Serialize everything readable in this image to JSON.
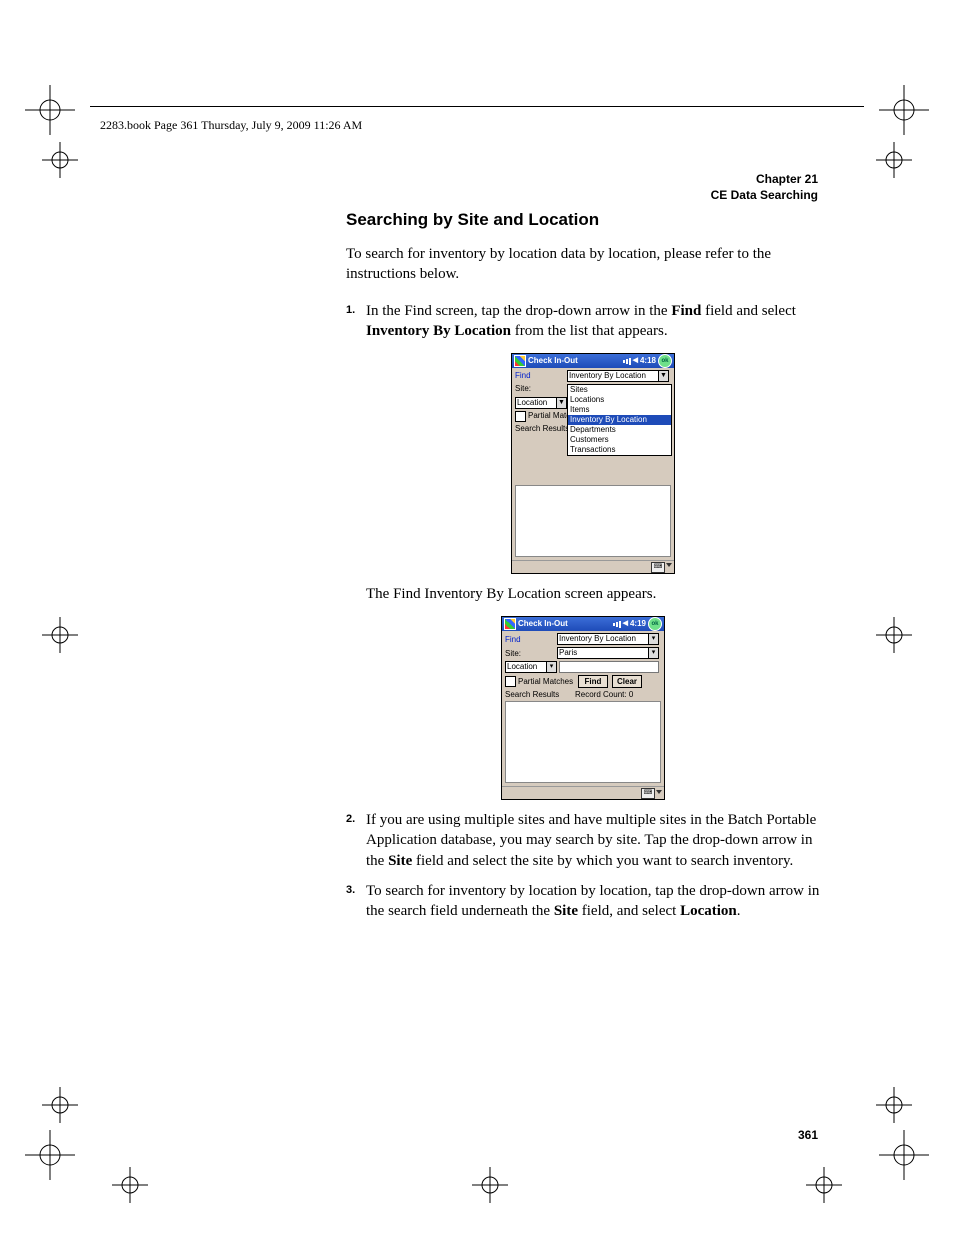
{
  "page_header": "2283.book  Page 361  Thursday, July 9, 2009  11:26 AM",
  "chapter_line1": "Chapter 21",
  "chapter_line2": "CE Data Searching",
  "section_title": "Searching by Site and Location",
  "intro": "To search for inventory by location data by location, please refer to the instructions below.",
  "step1_a": "In the Find screen, tap the drop-down arrow in the ",
  "step1_b": "Find",
  "step1_c": " field and select ",
  "step1_d": "Inventory By Location",
  "step1_e": " from the list that appears.",
  "caption1": "The Find Inventory By Location screen appears.",
  "step2_a": "If you are using multiple sites and have multiple sites in the Batch Portable Application database, you may search by site. Tap the drop-down arrow in the ",
  "step2_b": "Site",
  "step2_c": " field and select the site by which you want to search inventory.",
  "step3_a": "To search for inventory by location by location, tap the drop-down arrow in the search field underneath the ",
  "step3_b": "Site",
  "step3_c": " field, and select ",
  "step3_d": "Location",
  "step3_e": ".",
  "page_num": "361",
  "dev1": {
    "title": "Check In-Out",
    "time": "4:18",
    "find_label": "Find",
    "find_value": "Inventory By Location",
    "site_label": "Site:",
    "loc_label": "Location",
    "partial": "Partial Match",
    "results_label": "Search Results",
    "options": [
      "Sites",
      "Locations",
      "Items",
      "Inventory By Location",
      "Departments",
      "Customers",
      "Transactions"
    ]
  },
  "dev2": {
    "title": "Check In-Out",
    "time": "4:19",
    "find_label": "Find",
    "find_value": "Inventory By Location",
    "site_label": "Site:",
    "site_value": "Paris",
    "loc_label": "Location",
    "partial": "Partial Matches",
    "find_btn": "Find",
    "clear_btn": "Clear",
    "results_label": "Search Results",
    "record_count_label": "Record Count:",
    "record_count": "0",
    "ok": "ok"
  }
}
